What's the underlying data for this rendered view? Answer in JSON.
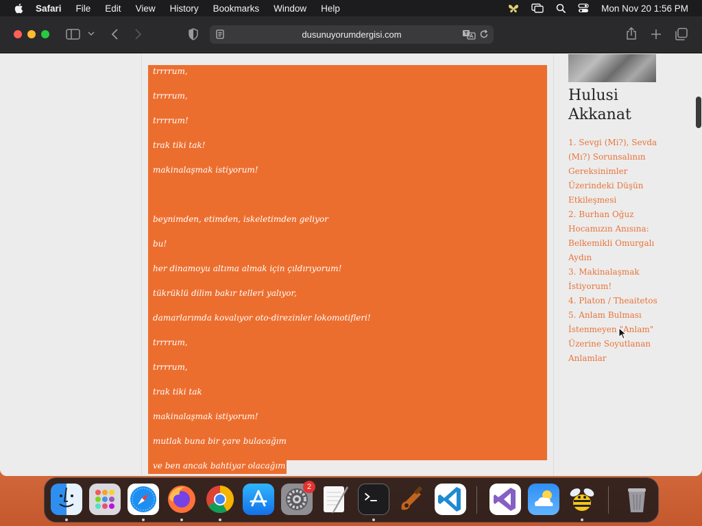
{
  "menubar": {
    "app_name": "Safari",
    "items": [
      "File",
      "Edit",
      "View",
      "History",
      "Bookmarks",
      "Window",
      "Help"
    ],
    "clock": "Mon Nov 20  1:56 PM",
    "status_icons": [
      "butterfly-icon",
      "screen-mirroring-icon",
      "search-icon",
      "control-center-icon"
    ]
  },
  "browser": {
    "url": "dusunuyorumdergisi.com"
  },
  "poem": {
    "lines": [
      "trrrrum,",
      "trrrrum,",
      "trrrrum!",
      "trak tiki tak!",
      "makinalaşmak istiyorum!",
      "",
      "beynimden, etimden, iskeletimden geliyor",
      "bu!",
      "her dinamoyu altıma almak için çıldırıyorum!",
      "tükrüklü dilim bakır telleri yalıyor,",
      "damarlarımda kovalıyor oto-direzinler lokomotifleri!",
      "trrrrum,",
      "trrrrum,",
      "trak tiki tak",
      "makinalaşmak istiyorum!",
      "mutlak buna bir çare bulacağım",
      "ve ben ancak bahtiyar olacağım"
    ]
  },
  "sidebar": {
    "author": "Hulusi Akkanat",
    "posts": [
      "1. Sevgi (Mi?), Sevda (Mı?) Sorunsalının Gereksinimler Üzerindeki Düşün Etkileşmesi",
      "2. Burhan Oğuz Hocamızın Anısına: Belkemikli Omurgalı Aydın",
      "3. Makinalaşmak İstiyorum!",
      "4. Platon / Theaitetos",
      "5. Anlam Bulması İstenmeyen \"Anlam\" Üzerine Soyutlanan Anlamlar"
    ]
  },
  "dock": {
    "apps": [
      "finder-icon",
      "launchpad-icon",
      "safari-icon",
      "firefox-icon",
      "chrome-icon",
      "app-store-icon",
      "system-settings-icon",
      "textedit-icon",
      "terminal-icon",
      "instruments-icon",
      "vscode-icon",
      "visual-studio-icon",
      "weather-icon",
      "cyberduck-icon",
      "trash-icon"
    ],
    "settings_badge": "2"
  },
  "colors": {
    "selection": "#ec6e2f",
    "link": "#e8743a"
  }
}
